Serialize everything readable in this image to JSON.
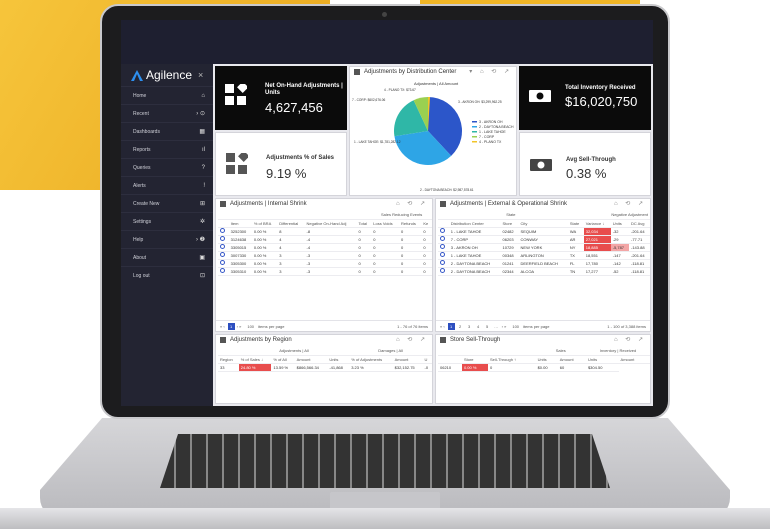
{
  "brand": {
    "name": "Agilence",
    "close": "×"
  },
  "nav": [
    {
      "label": "Home",
      "icon": "⌂"
    },
    {
      "label": "Recent",
      "icon": "›  ⊙"
    },
    {
      "label": "Dashboards",
      "icon": "▦"
    },
    {
      "label": "Reports",
      "icon": "ıl"
    },
    {
      "label": "Queries",
      "icon": "?"
    },
    {
      "label": "Alerts",
      "icon": "!"
    },
    {
      "label": "Create New",
      "icon": "⊞"
    },
    {
      "label": "Settings",
      "icon": "✲"
    },
    {
      "label": "Help",
      "icon": "›  ❷"
    },
    {
      "label": "About",
      "icon": "▣"
    },
    {
      "label": "Log out",
      "icon": "⊡"
    }
  ],
  "kpi": {
    "net": {
      "title": "Net On-Hand Adjustments | Units",
      "value": "4,627,456"
    },
    "pct": {
      "title": "Adjustments % of Sales",
      "value": "9.19 %"
    },
    "inv": {
      "title": "Total Inventory Received",
      "value": "$16,020,750"
    },
    "sell": {
      "title": "Avg Sell-Through",
      "value": "0.38 %"
    }
  },
  "pie": {
    "title": "Adjustments by Distribution Center",
    "subtitle": "Adjustments | All Amount",
    "slices": [
      {
        "name": "3 - AKRON OH",
        "label": "3 - AKRON OH: $3,299,962.25",
        "value": 3299962.25,
        "color": "#2c56c9"
      },
      {
        "name": "2 - DAYTONA BEACH",
        "label": "2 - DAYTONA BEACH: $2,987,578.61",
        "value": 2987578.61,
        "color": "#2ea5e6"
      },
      {
        "name": "1 - LAKE TAHOE",
        "label": "1 - LAKE TAHOE: $1,781,282.12",
        "value": 1781282.12,
        "color": "#2fb7a7"
      },
      {
        "name": "7 - CORP",
        "label": "7 - CORP: $602,676.06",
        "value": 602676.06,
        "color": "#9ad051"
      },
      {
        "name": "4 - PLANO TX",
        "label": "4 - PLANO TX: $73.67",
        "value": 73.67,
        "color": "#f2c529"
      }
    ]
  },
  "shrink": {
    "title": "Adjustments | Internal Shrink",
    "group": "Sales Reducing Events",
    "cols": [
      "Item",
      "% of BRA",
      "Differential",
      "Negative On-Hand Adj",
      "Total",
      "Loss Voids",
      "Refunds",
      "Ke"
    ],
    "rows": [
      [
        "3252300",
        "0.00 %",
        "8",
        "-8",
        "0",
        "0",
        "0",
        "0"
      ],
      [
        "3124638",
        "0.00 %",
        "4",
        "-4",
        "0",
        "0",
        "0",
        "0"
      ],
      [
        "3305015",
        "0.00 %",
        "4",
        "-4",
        "0",
        "0",
        "0",
        "0"
      ],
      [
        "3007330",
        "0.00 %",
        "3",
        "-3",
        "0",
        "0",
        "0",
        "0"
      ],
      [
        "3305300",
        "0.00 %",
        "3",
        "-3",
        "0",
        "0",
        "0",
        "0"
      ],
      [
        "3305310",
        "0.00 %",
        "3",
        "-3",
        "0",
        "0",
        "0",
        "0"
      ]
    ],
    "pager": {
      "pages": [
        "1"
      ],
      "size": "100",
      "per": "items per page",
      "range": "1 - 76 of 76 items"
    }
  },
  "ext": {
    "title": "Adjustments | External & Operational Shrink",
    "group1": "State",
    "group2": "Negative Adjustment",
    "cols": [
      "Distribution Center",
      "Store",
      "City",
      "State",
      "Variance ↓",
      "Units",
      "DC Avg"
    ],
    "rows": [
      [
        "1 - LAKE TAHOE",
        "02482",
        "SEQUIM",
        "WA",
        "32,034",
        "-32",
        "-201.64"
      ],
      [
        "7 - CORP",
        "06203",
        "CONWAY",
        "AR",
        "27,021",
        "-29",
        "-77.71"
      ],
      [
        "3 - AKRON OH",
        "10729",
        "NEW YORK",
        "NY",
        "18,885",
        "-5,787",
        "-143.88"
      ],
      [
        "1 - LAKE TAHOE",
        "00348",
        "ARLINGTON",
        "TX",
        "18,551",
        "-147",
        "-201.64"
      ],
      [
        "2 - DAYTONA BEACH",
        "01241",
        "DEERFIELD BEACH",
        "FL",
        "17,780",
        "-142",
        "-118.81"
      ],
      [
        "2 - DAYTONA BEACH",
        "02344",
        "ALCOA",
        "TN",
        "17,277",
        "-52",
        "-118.81"
      ]
    ],
    "pager": {
      "pages": [
        "1",
        "2",
        "3",
        "4",
        "5",
        "…"
      ],
      "size": "100",
      "per": "items per page",
      "range": "1 - 100 of 3,388 items"
    }
  },
  "region": {
    "title": "Adjustments by Region",
    "g1": "Adjustments | All",
    "g2": "Damages | All",
    "cols": [
      "Region",
      "% of Sales ↓",
      "% of All",
      "Amount",
      "Units",
      "% of Adjustments",
      "Amount",
      "U"
    ],
    "rows": [
      [
        "33",
        "24.80 %",
        "13.59 %",
        "$866,566.34",
        "-41,868",
        "3.23 %",
        "$32,152.75",
        "-0"
      ]
    ]
  },
  "sell": {
    "title": "Store Sell-Through",
    "g1": "Sales",
    "g2": "Inventory | Received",
    "cols": [
      "Store",
      "Sell-Through ↑",
      "Units",
      "Amount",
      "Units",
      "Amount"
    ],
    "rows": [
      [
        "06210",
        "0.00 %",
        "0",
        "$0.00",
        "60",
        "$304.50"
      ]
    ]
  }
}
